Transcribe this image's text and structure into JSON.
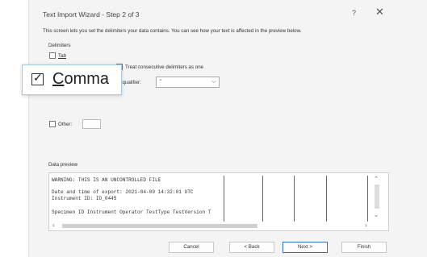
{
  "window": {
    "title": "Text Import Wizard - Step 2 of 3",
    "help_glyph": "?",
    "close_glyph": "✕"
  },
  "description": "This screen lets you set the delimiters your data contains.  You can see how your text is affected in the preview below.",
  "delimiters": {
    "label": "Delimiters",
    "tab": {
      "label": "Tab",
      "checked": false
    },
    "comma": {
      "label": "Comma",
      "checked": true
    },
    "other": {
      "label": "Other:",
      "checked": false,
      "value": ""
    }
  },
  "consecutive": {
    "label": "Treat consecutive delimiters as one",
    "checked": false
  },
  "text_qualifier": {
    "label": "t qualifier:",
    "value": "\"",
    "chevron": "⌵"
  },
  "preview": {
    "label": "Data preview",
    "lines": [
      "WARNING: THIS IS AN UNCONTROLLED FILE",
      "",
      "Date and time of export: 2021-04-09 14:32:01 UTC",
      "Instrument ID: IO_0445",
      "",
      "Specimen ID                                Instrument Operator TestType TestVersion T"
    ],
    "scroll_up": "⌃",
    "scroll_down": "⌄",
    "scroll_left": "‹",
    "scroll_right": "›"
  },
  "buttons": {
    "cancel": "Cancel",
    "back": "< Back",
    "next": "Next >",
    "finish": "Finish"
  },
  "colors": {
    "dialog_bg": "#f4f4f4",
    "accent_border": "#2f6fbf",
    "zoom_border": "#a9c9e9"
  }
}
